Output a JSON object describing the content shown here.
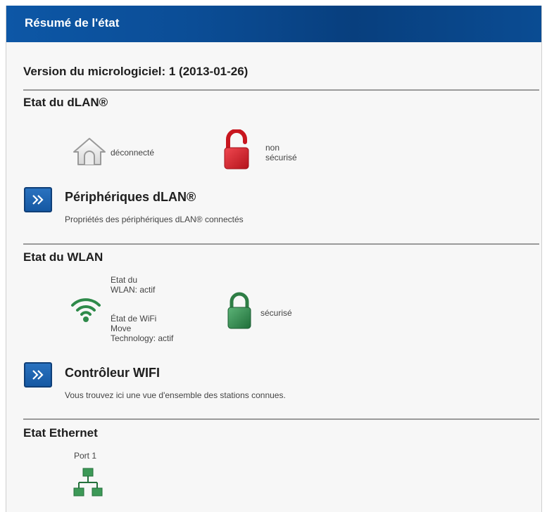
{
  "header": {
    "title": "Résumé de l'état"
  },
  "firmware": {
    "label": "Version du micrologiciel: 1 (2013-01-26)"
  },
  "dlan": {
    "section_title": "Etat du dLAN®",
    "connection_status": "déconnecté",
    "security_status_line1": "non",
    "security_status_line2": "sécurisé",
    "devices_link": {
      "title": "Périphériques dLAN®",
      "description": "Propriétés des périphériques dLAN® connectés"
    }
  },
  "wlan": {
    "section_title": "Etat du WLAN",
    "status_line1": "Etat du",
    "status_line2": "WLAN: actif",
    "move_line1": "État de WiFi",
    "move_line2": "Move",
    "move_line3": "Technology: actif",
    "security_status": "sécurisé",
    "controller_link": {
      "title": "Contrôleur WIFI",
      "description": "Vous trouvez ici une vue d'ensemble des stations connues."
    }
  },
  "ethernet": {
    "section_title": "Etat Ethernet",
    "port_label": "Port 1"
  },
  "icons": {
    "house": "house-icon",
    "lock_open": "open-lock-icon",
    "lock_closed": "closed-lock-icon",
    "wifi": "wifi-icon",
    "network": "network-icon",
    "chevron": "double-chevron-right-icon"
  },
  "colors": {
    "header_blue": "#0b4d96",
    "button_blue": "#1a5fa8",
    "lock_red": "#d8202a",
    "status_green": "#2e8a4a"
  }
}
